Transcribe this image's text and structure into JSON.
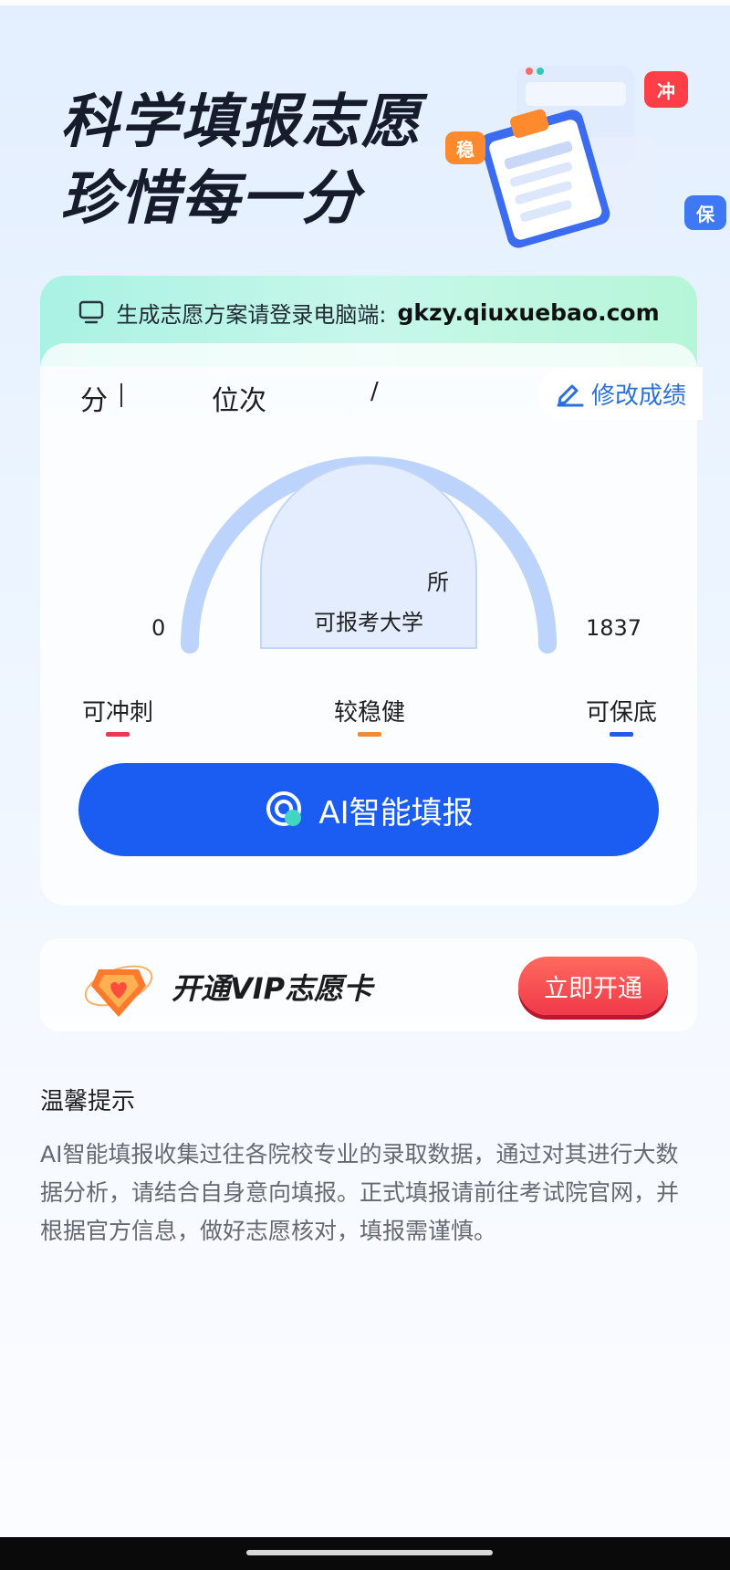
{
  "hero": {
    "title_line1": "科学填报志愿",
    "title_line2": "珍惜每一分",
    "tags": {
      "chong": "冲",
      "wen": "稳",
      "bao": "保"
    }
  },
  "banner": {
    "prefix": "生成志愿方案请登录电脑端:",
    "url": "gkzy.qiuxuebao.com",
    "icon": "monitor-icon"
  },
  "score": {
    "score_label": "分",
    "rank_label": "位次",
    "separator": "/",
    "edit_label": "修改成绩",
    "edit_icon": "pencil-icon"
  },
  "gauge": {
    "min": "0",
    "max": "1837",
    "count_unit": "所",
    "caption": "可报考大学"
  },
  "legend": [
    {
      "label": "可冲刺",
      "color": "#ef3752"
    },
    {
      "label": "较稳健",
      "color": "#f28a2f"
    },
    {
      "label": "可保底",
      "color": "#1d5de8"
    }
  ],
  "ai_button": {
    "label": "AI智能填报"
  },
  "vip": {
    "text": "开通VIP志愿卡",
    "button": "立即开通"
  },
  "tips": {
    "title": "温馨提示",
    "body": "AI智能填报收集过往各院校专业的录取数据，通过对其进行大数据分析，请结合自身意向填报。正式填报请前往考试院官网，并根据官方信息，做好志愿核对，填报需谨慎。"
  },
  "colors": {
    "primary": "#1b5df2",
    "vip_red": "#f0394a",
    "banner_green": "#b6f6d8"
  }
}
